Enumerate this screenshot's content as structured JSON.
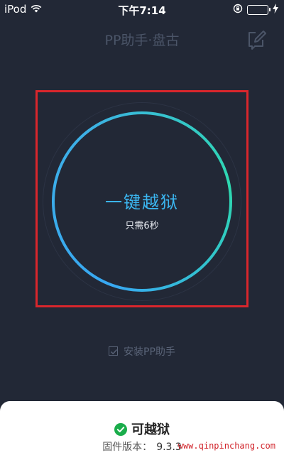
{
  "status_bar": {
    "carrier": "iPod",
    "time": "下午7:14",
    "battery_level": 1.0,
    "icons": [
      "wifi-icon",
      "rotation-lock-icon",
      "battery-icon",
      "charging-icon"
    ]
  },
  "nav": {
    "title": "PP助手·盘古",
    "right_icon": "edit-icon"
  },
  "jailbreak": {
    "title": "一键越狱",
    "subtitle": "只需6秒",
    "ring_gradient": [
      "#38a8f2",
      "#2ed9b0"
    ]
  },
  "install_option": {
    "label": "安装PP助手",
    "checked": true
  },
  "result": {
    "status": "可越狱",
    "firmware_label": "固件版本：",
    "firmware_value": "9.3.3"
  },
  "watermark": "www.qinpinchang.com",
  "colors": {
    "background": "#222836",
    "accent": "#3bb6f0",
    "highlight": "#d9262c",
    "success": "#1aad4b"
  }
}
